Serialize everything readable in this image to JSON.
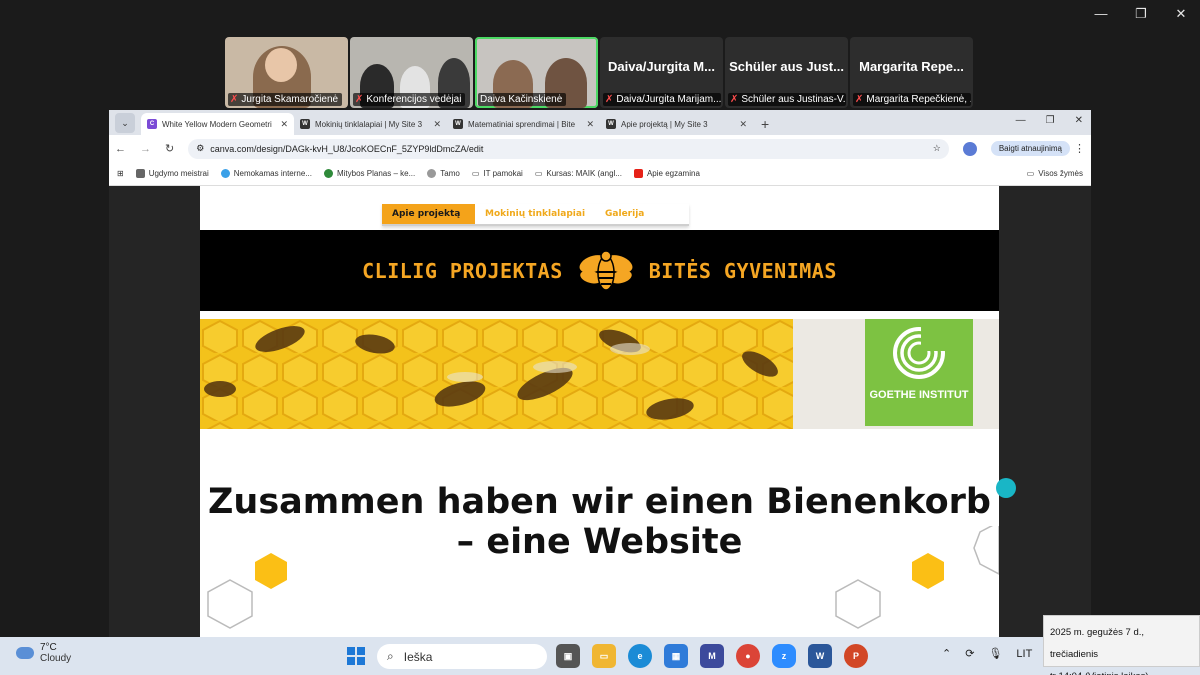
{
  "window_controls": {
    "minimize": "—",
    "restore": "❐",
    "close": "✕"
  },
  "participants": [
    {
      "type": "video",
      "label": "Jurgita Skamaročienė"
    },
    {
      "type": "video",
      "label": "Konferencijos vedėjai"
    },
    {
      "type": "video",
      "label": "Daiva Kačinskienė",
      "active": true
    },
    {
      "type": "name",
      "big": "Daiva/Jurgita  M...",
      "label": "Daiva/Jurgita Marijam..."
    },
    {
      "type": "name",
      "big": "Schüler aus Just...",
      "label": "Schüler aus Justinas-V..."
    },
    {
      "type": "name",
      "big": "Margarita  Repe...",
      "label": "Margarita Repečkienė, ..."
    }
  ],
  "browser": {
    "tabs": [
      {
        "title": "White Yellow Modern Geometri",
        "active": true,
        "fav_color": "#7b4bd6"
      },
      {
        "title": "Mokinių tinklalapiai | My Site 3",
        "active": false,
        "fav_color": "#333333"
      },
      {
        "title": "Matematiniai sprendimai | Bite",
        "active": false,
        "fav_color": "#333333"
      },
      {
        "title": "Apie projektą | My Site 3",
        "active": false,
        "fav_color": "#333333"
      }
    ],
    "new_tab": "+",
    "url": "canva.com/design/DAGk-kvH_U8/JcoKOECnF_5ZYP9ldDmcZA/edit",
    "resume_button": "Baigti atnaujinimą",
    "bookmarks": [
      "Ugdymo meistrai",
      "Nemokamas interne...",
      "Mitybos Planas – ke...",
      "Tamo",
      "IT pamokai",
      "Kursas: MAIK (angl...",
      "Apie egzamina"
    ],
    "bookmarks_all": "Visos žymės"
  },
  "page": {
    "nav": [
      "Apie projektą",
      "Mokinių tinklalapiai",
      "Galerija"
    ],
    "banner_left": "CLILIG PROJEKTAS",
    "banner_right": "BITĖS GYVENIMAS",
    "goethe": "GOETHE INSTITUT",
    "headline_1": "Zusammen haben wir einen Bienenkorb",
    "headline_2": "– eine Website"
  },
  "taskbar": {
    "temp": "7°C",
    "weather": "Cloudy",
    "search_placeholder": "Ieška",
    "lang": "LIT"
  },
  "clock_popup": {
    "date": "2025 m. gegužės 7 d., trečiadienis",
    "time": "tr 14:04 (Vietinis laikas)"
  },
  "colors": {
    "accent": "#f5a623",
    "goethe": "#7dc242",
    "active_speaker": "#4cd964"
  }
}
